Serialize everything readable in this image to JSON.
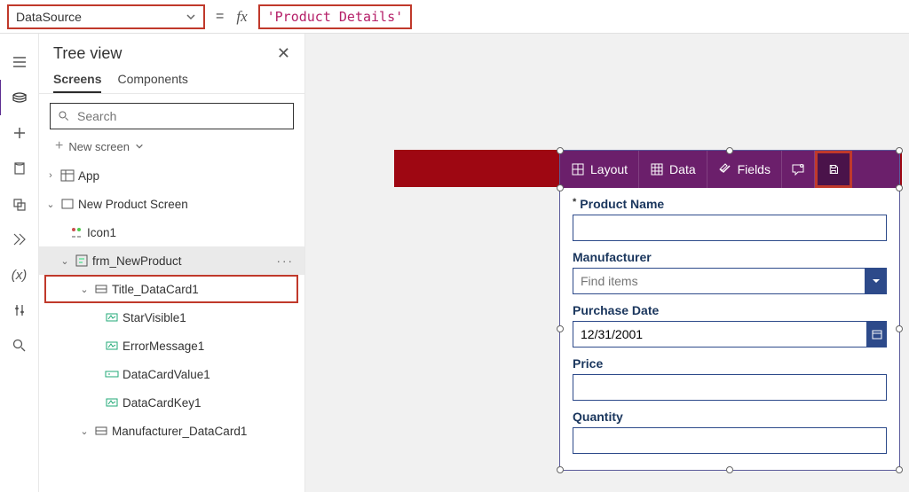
{
  "formula": {
    "property": "DataSource",
    "equals": "=",
    "fx": "fx",
    "value": "'Product Details'"
  },
  "tree": {
    "title": "Tree view",
    "tabs": {
      "screens": "Screens",
      "components": "Components"
    },
    "search_placeholder": "Search",
    "newscreen": "New screen",
    "nodes": {
      "app": "App",
      "screen": "New Product Screen",
      "icon1": "Icon1",
      "form": "frm_NewProduct",
      "title_dc": "Title_DataCard1",
      "starvis": "StarVisible1",
      "errmsg": "ErrorMessage1",
      "dcval": "DataCardValue1",
      "dckey": "DataCardKey1",
      "manuf_dc": "Manufacturer_DataCard1"
    }
  },
  "form": {
    "toolbar": {
      "layout": "Layout",
      "data": "Data",
      "fields": "Fields"
    },
    "product_name_label": "Product Name",
    "manufacturer_label": "Manufacturer",
    "manufacturer_placeholder": "Find items",
    "purchase_date_label": "Purchase Date",
    "purchase_date_value": "12/31/2001",
    "price_label": "Price",
    "quantity_label": "Quantity"
  }
}
